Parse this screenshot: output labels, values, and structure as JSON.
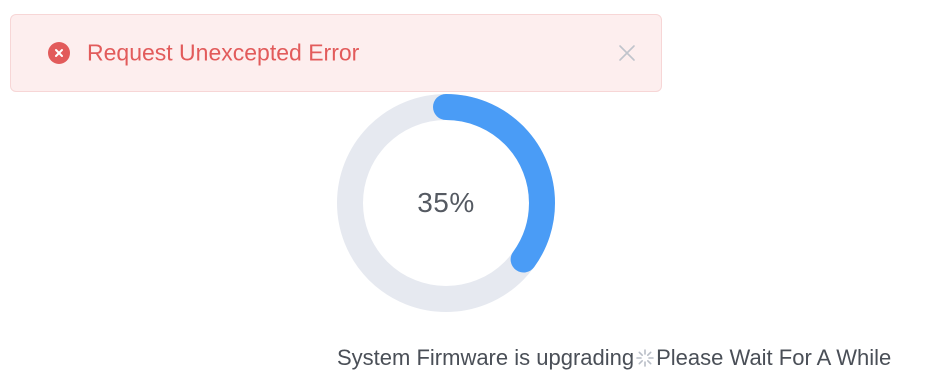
{
  "toast": {
    "message": "Request Unexcepted Error",
    "icon": "error-circle-icon",
    "close_icon": "close-icon",
    "color": "#e25b5b",
    "background": "#fdeeee"
  },
  "progress": {
    "percent": 35,
    "label": "35%",
    "track_color": "#e6e9f0",
    "bar_color": "#4a9cf6"
  },
  "status": {
    "text_before": "System Firmware is upgrading",
    "spinner_icon": "loading-spinner-icon",
    "text_after": "Please Wait For A While"
  }
}
